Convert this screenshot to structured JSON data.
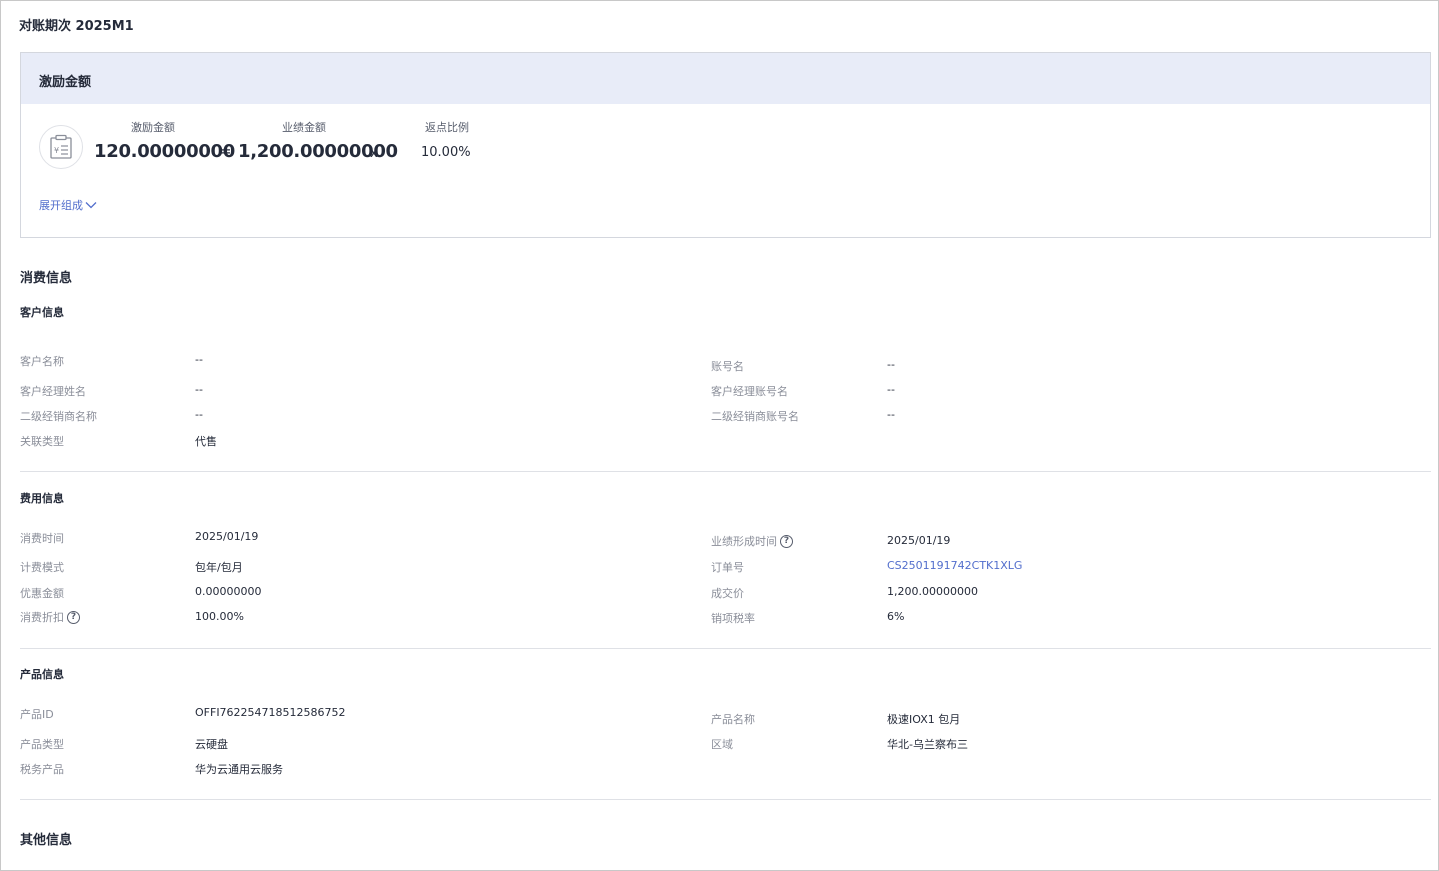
{
  "period_title": "对账期次 2025M1",
  "incentive": {
    "title": "激励金额",
    "labels": {
      "incentive": "激励金额",
      "performance": "业绩金额",
      "rebate": "返点比例"
    },
    "values": {
      "incentive": "120.00000000",
      "performance": "1,200.00000000",
      "rebate": "10.00%"
    },
    "ops": {
      "equals": "=",
      "times": "x"
    },
    "expand_label": "展开组成",
    "icon": "receipt-icon"
  },
  "consumption_title": "消费信息",
  "customer": {
    "title": "客户信息",
    "left": [
      {
        "label": "客户名称",
        "value": "--"
      },
      {
        "label": "客户经理姓名",
        "value": "--"
      },
      {
        "label": "二级经销商名称",
        "value": "--"
      },
      {
        "label": "关联类型",
        "value": "代售"
      }
    ],
    "right": [
      {
        "label": "账号名",
        "value": "--"
      },
      {
        "label": "客户经理账号名",
        "value": "--"
      },
      {
        "label": "二级经销商账号名",
        "value": "--"
      }
    ]
  },
  "fee": {
    "title": "费用信息",
    "left": [
      {
        "label": "消费时间",
        "value": "2025/01/19"
      },
      {
        "label": "计费模式",
        "value": "包年/包月"
      },
      {
        "label": "优惠金额",
        "value": "0.00000000"
      },
      {
        "label": "消费折扣",
        "value": "100.00%",
        "help": "?"
      }
    ],
    "right": [
      {
        "label": "业绩形成时间",
        "value": "2025/01/19",
        "help": "?"
      },
      {
        "label": "订单号",
        "value": "CS2501191742CTK1XLG"
      },
      {
        "label": "成交价",
        "value": "1,200.00000000"
      },
      {
        "label": "销项税率",
        "value": "6%"
      }
    ]
  },
  "product": {
    "title": "产品信息",
    "left": [
      {
        "label": "产品ID",
        "value": "OFFI762254718512586752"
      },
      {
        "label": "产品类型",
        "value": "云硬盘"
      },
      {
        "label": "税务产品",
        "value": "华为云通用云服务"
      }
    ],
    "right": [
      {
        "label": "产品名称",
        "value": "极速IOX1 包月"
      },
      {
        "label": "区域",
        "value": "华北-乌兰察布三"
      }
    ]
  },
  "other_title": "其他信息",
  "colors": {
    "accent": "#526ecc",
    "header_bg": "#e8ecf8",
    "label": "#8a8e99"
  }
}
